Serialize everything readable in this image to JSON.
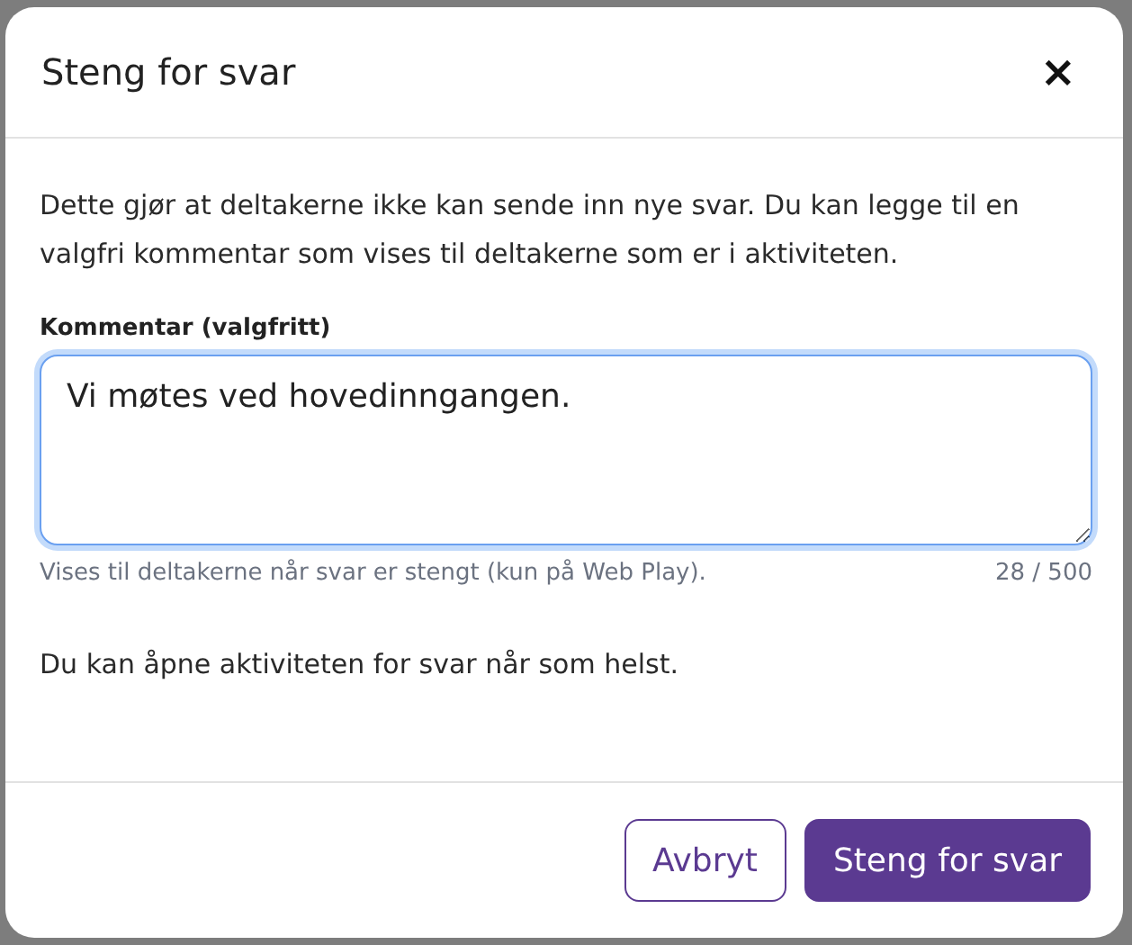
{
  "dialog": {
    "title": "Steng for svar",
    "close": "×",
    "description": "Dette gjør at deltakerne ikke kan sende inn nye svar. Du kan legge til en valgfri kommentar som vises til deltakerne som er i aktiviteten.",
    "comment": {
      "label": "Kommentar (valgfritt)",
      "value": "Vi møtes ved hovedinngangen.",
      "focused": true,
      "hint": "Vises til deltakerne når svar er stengt (kun på Web Play).",
      "counter": "28 / 500"
    },
    "note": "Du kan åpne aktiviteten for svar når som helst.",
    "buttons": [
      {
        "label": "Avbryt",
        "kind": "secondary"
      },
      {
        "label": "Steng for svar",
        "kind": "primary"
      }
    ]
  }
}
